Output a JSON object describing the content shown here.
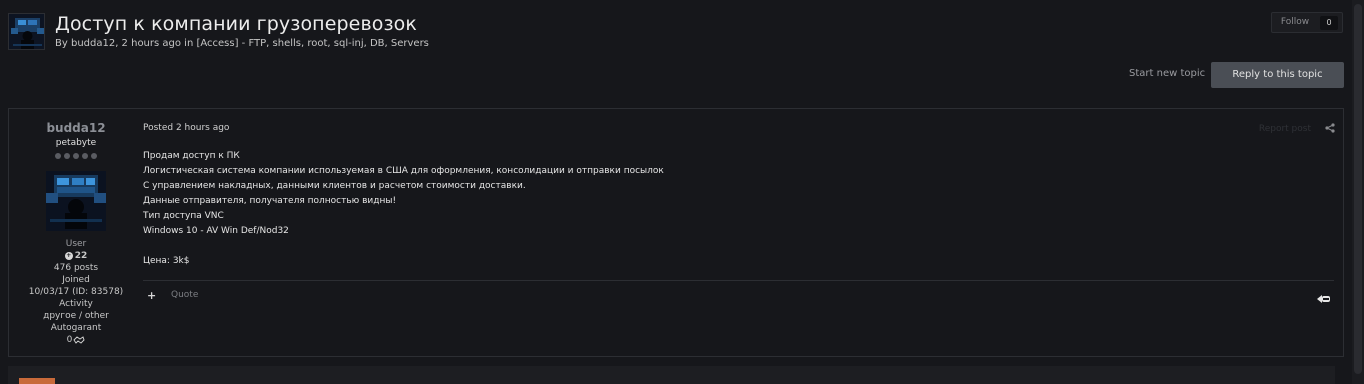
{
  "topic": {
    "title": "Доступ к компании грузоперевозок",
    "by_label": "By ",
    "author": "budda12",
    "age": ", 2 hours ago in ",
    "forum": "[Access] - FTP, shells, root, sql-inj, DB, Servers"
  },
  "follow": {
    "label": "Follow",
    "count": "0"
  },
  "actions": {
    "start_new_topic": "Start new topic",
    "reply": "Reply to this topic"
  },
  "post": {
    "author": {
      "name": "budda12",
      "title": "petabyte",
      "group": "User",
      "reputation": "22",
      "posts": "476 posts",
      "joined_label": "Joined",
      "joined_value": "10/03/17 (ID: 83578)",
      "activity_label": "Activity",
      "activity_value": "другое / other",
      "autogarant_label": "Autogarant",
      "autogarant_value": "0"
    },
    "date": "Posted 2 hours ago",
    "report": "Report post",
    "lines": [
      "Продам доступ к ПК",
      "Логистическая система компании используемая в США для оформления, консолидации и отправки посылок",
      "С управлением накладных, данными клиентов и расчетом стоимости доставки.",
      "Данные отправителя, получателя полностью видны!",
      "Тип доступа VNC",
      "Windows 10 - AV Win Def/Nod32",
      "",
      "Цена: 3k$"
    ],
    "multiquote": "+",
    "quote": "Quote"
  },
  "colors": {
    "background": "#16171b",
    "border": "#2c2e33",
    "reply_button": "#4a4e55",
    "author_name": "#8c8f96"
  },
  "icons": [
    "topic-avatar-image",
    "share-icon",
    "reputation-icon",
    "handshake-icon",
    "reply-arrow-icon"
  ]
}
